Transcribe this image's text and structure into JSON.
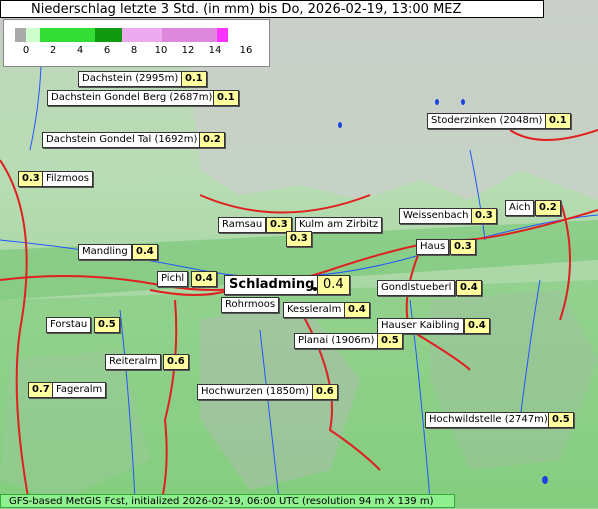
{
  "title": "Niederschlag letzte 3 Std. (in mm) bis Do, 2026-02-19, 13:00 MEZ",
  "legend": {
    "ticks": [
      "0",
      "2",
      "4",
      "6",
      "8",
      "10",
      "12",
      "14",
      "16"
    ],
    "colors": [
      "#aaaaaa",
      "#ccffcc",
      "#66ee66",
      "#11cc11",
      "#008800",
      "#eeaaee",
      "#dd88dd",
      "#cc66cc",
      "#ff33ff"
    ]
  },
  "stations": [
    {
      "name": "Dachstein (2995m)",
      "value": "0.1"
    },
    {
      "name": "Dachstein Gondel Berg (2687m)",
      "value": "0.1"
    },
    {
      "name": "Dachstein Gondel Tal (1692m)",
      "value": "0.2"
    },
    {
      "name": "Filzmoos",
      "value": "0.3"
    },
    {
      "name": "Stoderzinken (2048m)",
      "value": "0.1"
    },
    {
      "name": "Weissenbach",
      "value": "0.3"
    },
    {
      "name": "Aich",
      "value": "0.2"
    },
    {
      "name": "Ramsau",
      "value": "0.3"
    },
    {
      "name": "Kulm am Zirbitz",
      "value": "0.3"
    },
    {
      "name": "Haus",
      "value": "0.3"
    },
    {
      "name": "Mandling",
      "value": "0.4"
    },
    {
      "name": "Pichl",
      "value": "0.4"
    },
    {
      "name": "Schladming",
      "value": "0.4"
    },
    {
      "name": "Gondlstueberl",
      "value": "0.4"
    },
    {
      "name": "Rohrmoos",
      "value": ""
    },
    {
      "name": "Kessleralm",
      "value": "0.4"
    },
    {
      "name": "Forstau",
      "value": "0.5"
    },
    {
      "name": "Hauser Kaibling",
      "value": "0.4"
    },
    {
      "name": "Planai (1906m)",
      "value": "0.5"
    },
    {
      "name": "Reiteralm",
      "value": "0.6"
    },
    {
      "name": "Fageralm",
      "value": "0.7"
    },
    {
      "name": "Hochwurzen (1850m)",
      "value": "0.6"
    },
    {
      "name": "Hochwildstelle (2747m)",
      "value": "0.5"
    }
  ],
  "footer": "GFS-based MetGIS Fcst, initialized 2026-02-19, 06:00 UTC  (resolution 94 m X 139 m)"
}
